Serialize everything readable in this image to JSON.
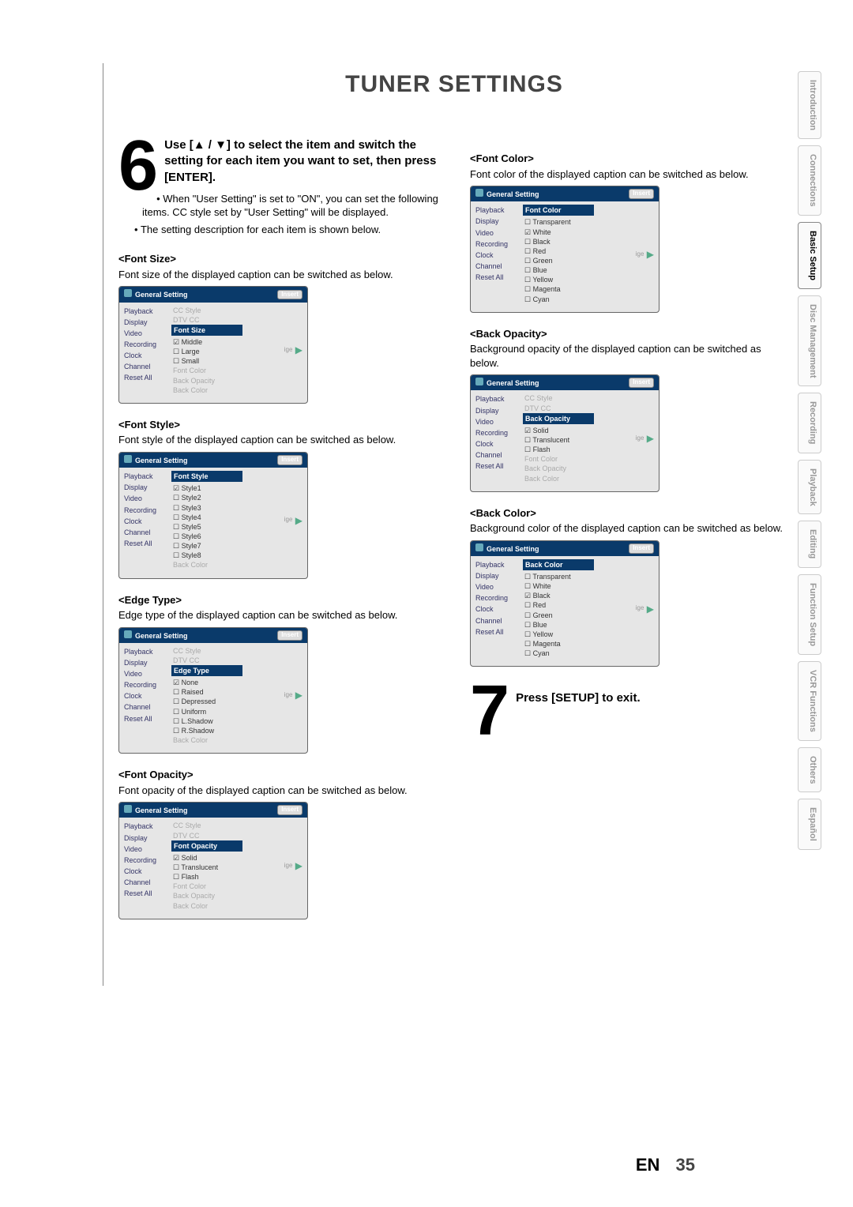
{
  "title": "TUNER SETTINGS",
  "step6": {
    "number": "6",
    "heading": "Use [▲ / ▼] to select the item and switch the setting for each item you want to set, then press [ENTER].",
    "bullets": [
      "When \"User Setting\" is set to \"ON\", you can set the following items. CC style set by \"User Setting\" will be displayed.",
      "The setting description for each item is shown below."
    ]
  },
  "osd_common": {
    "window_title": "General Setting",
    "insert_label": "Insert",
    "left_menu": [
      "Playback",
      "Display",
      "Video",
      "Recording",
      "Clock",
      "Channel",
      "Reset All"
    ],
    "cc_style": "CC Style",
    "dtv_cc": "DTV CC",
    "trail_suffix": "ige",
    "arrow": "▶"
  },
  "sections": [
    {
      "key": "font_size",
      "head": "<Font Size>",
      "desc": "Font size of the displayed caption can be switched as below.",
      "header": "Font Size",
      "above": [
        "CC Style",
        "DTV CC"
      ],
      "options": [
        {
          "label": "Middle",
          "sel": true
        },
        {
          "label": "Large",
          "sel": false
        },
        {
          "label": "Small",
          "sel": false
        }
      ],
      "below": [
        "Font Color",
        "Back Opacity",
        "Back Color"
      ]
    },
    {
      "key": "font_style",
      "head": "<Font Style>",
      "desc": "Font style of the displayed caption can be switched as below.",
      "header": "Font Style",
      "above": [],
      "options": [
        {
          "label": "Style1",
          "sel": true
        },
        {
          "label": "Style2",
          "sel": false
        },
        {
          "label": "Style3",
          "sel": false
        },
        {
          "label": "Style4",
          "sel": false
        },
        {
          "label": "Style5",
          "sel": false
        },
        {
          "label": "Style6",
          "sel": false
        },
        {
          "label": "Style7",
          "sel": false
        },
        {
          "label": "Style8",
          "sel": false
        }
      ],
      "below": [
        "Back Color"
      ]
    },
    {
      "key": "edge_type",
      "head": "<Edge Type>",
      "desc": "Edge type of the displayed caption can be switched as below.",
      "header": "Edge Type",
      "above": [
        "CC Style",
        "DTV CC"
      ],
      "options": [
        {
          "label": "None",
          "sel": true
        },
        {
          "label": "Raised",
          "sel": false
        },
        {
          "label": "Depressed",
          "sel": false
        },
        {
          "label": "Uniform",
          "sel": false
        },
        {
          "label": "L.Shadow",
          "sel": false
        },
        {
          "label": "R.Shadow",
          "sel": false
        }
      ],
      "below": [
        "Back Color"
      ]
    },
    {
      "key": "font_opacity",
      "head": "<Font Opacity>",
      "desc": "Font opacity of the displayed caption can be switched as below.",
      "header": "Font Opacity",
      "above": [
        "CC Style",
        "DTV CC"
      ],
      "options": [
        {
          "label": "Solid",
          "sel": true
        },
        {
          "label": "Translucent",
          "sel": false
        },
        {
          "label": "Flash",
          "sel": false
        }
      ],
      "below": [
        "Font Color",
        "Back Opacity",
        "Back Color"
      ]
    },
    {
      "key": "font_color",
      "head": "<Font Color>",
      "desc": "Font color of the displayed caption can be switched as below.",
      "header": "Font Color",
      "above": [],
      "options": [
        {
          "label": "Transparent",
          "sel": false
        },
        {
          "label": "White",
          "sel": true
        },
        {
          "label": "Black",
          "sel": false
        },
        {
          "label": "Red",
          "sel": false
        },
        {
          "label": "Green",
          "sel": false
        },
        {
          "label": "Blue",
          "sel": false
        },
        {
          "label": "Yellow",
          "sel": false
        },
        {
          "label": "Magenta",
          "sel": false
        },
        {
          "label": "Cyan",
          "sel": false
        }
      ],
      "below": []
    },
    {
      "key": "back_opacity",
      "head": "<Back Opacity>",
      "desc": "Background opacity of the displayed caption can be switched as below.",
      "header": "Back Opacity",
      "above": [
        "CC Style",
        "DTV CC"
      ],
      "options": [
        {
          "label": "Solid",
          "sel": true
        },
        {
          "label": "Translucent",
          "sel": false
        },
        {
          "label": "Flash",
          "sel": false
        }
      ],
      "below": [
        "Font Color",
        "Back Opacity",
        "Back Color"
      ]
    },
    {
      "key": "back_color",
      "head": "<Back Color>",
      "desc": "Background color of the displayed caption can be switched as below.",
      "header": "Back Color",
      "above": [],
      "options": [
        {
          "label": "Transparent",
          "sel": false
        },
        {
          "label": "White",
          "sel": false
        },
        {
          "label": "Black",
          "sel": true
        },
        {
          "label": "Red",
          "sel": false
        },
        {
          "label": "Green",
          "sel": false
        },
        {
          "label": "Blue",
          "sel": false
        },
        {
          "label": "Yellow",
          "sel": false
        },
        {
          "label": "Magenta",
          "sel": false
        },
        {
          "label": "Cyan",
          "sel": false
        }
      ],
      "below": []
    }
  ],
  "step7": {
    "number": "7",
    "text": "Press [SETUP] to exit."
  },
  "tabs": [
    "Introduction",
    "Connections",
    "Basic Setup",
    "Disc Management",
    "Recording",
    "Playback",
    "Editing",
    "Function Setup",
    "VCR Functions",
    "Others",
    "Español"
  ],
  "active_tab": "Basic Setup",
  "page": {
    "lang": "EN",
    "num": "35"
  }
}
